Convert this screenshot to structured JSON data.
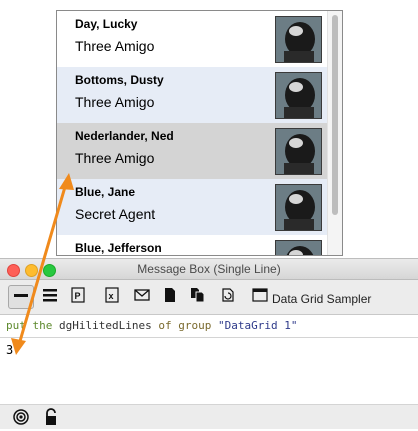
{
  "data_grid": {
    "rows": [
      {
        "name": "Day, Lucky",
        "role": "Three Amigo",
        "bg": "#ffffff"
      },
      {
        "name": "Bottoms, Dusty",
        "role": "Three Amigo",
        "bg": "#e6ecf6"
      },
      {
        "name": "Nederlander, Ned",
        "role": "Three Amigo",
        "bg": "#d4d4d4"
      },
      {
        "name": "Blue, Jane",
        "role": "Secret Agent",
        "bg": "#e6ecf6"
      },
      {
        "name": "Blue, Jefferson",
        "role": "",
        "bg": "#ffffff"
      }
    ]
  },
  "message_box": {
    "title": "Message Box (Single Line)",
    "stack_name": "Data Grid Sampler",
    "script_tokens": {
      "put": "put",
      "the": "the",
      "prop": "dgHilitedLines",
      "of": "of",
      "group": "group",
      "target": "\"DataGrid 1\""
    },
    "result": "3"
  },
  "colors": {
    "close": "#fe5f57",
    "minimize": "#febc2e",
    "zoom": "#28c840",
    "arrow": "#f08a1c"
  },
  "icons": {
    "toolbar": [
      "single-line-icon",
      "multi-line-icon",
      "property-icon",
      "global-icon",
      "mail-icon",
      "file-icon",
      "files-icon",
      "refresh-icon",
      "stack-icon"
    ],
    "status": [
      "target-icon",
      "lock-icon"
    ]
  }
}
